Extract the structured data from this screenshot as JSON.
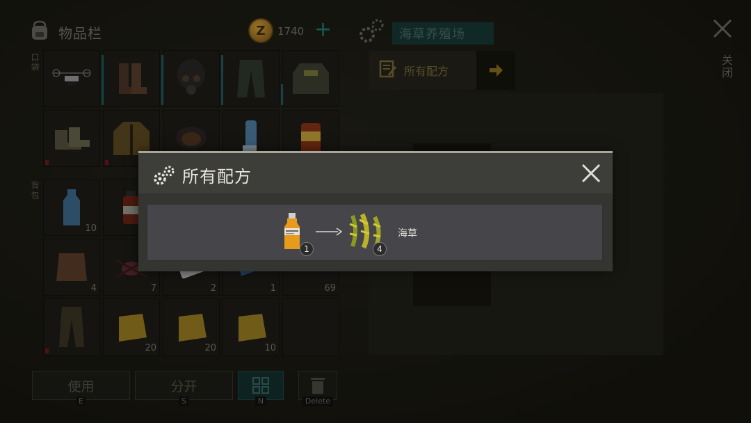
{
  "inventory": {
    "title": "物品栏",
    "coins": "1740",
    "equipment_label": "口袋",
    "backpack_label": "背包",
    "counts": {
      "bottle": "10",
      "hide": "4",
      "spider": "7",
      "phone": "2",
      "battery": "1",
      "trap": "69",
      "cloth1": "20",
      "cloth2": "20",
      "cloth3": "10"
    },
    "buttons": {
      "use": "使用",
      "use_key": "E",
      "split": "分开",
      "split_key": "S",
      "sort_key": "N",
      "delete_key": "Delete"
    }
  },
  "station": {
    "name": "海草养殖场",
    "recipes_tab": "所有配方",
    "close_label": "关闭"
  },
  "modal": {
    "title": "所有配方",
    "recipe": {
      "ingredient_qty": "1",
      "result_qty": "4",
      "result_name": "海草"
    }
  },
  "colors": {
    "accent_teal": "#1e7f7c",
    "modal_bg": "#3b3b37",
    "recipe_row": "#45454a",
    "gold": "#d7a23a"
  }
}
